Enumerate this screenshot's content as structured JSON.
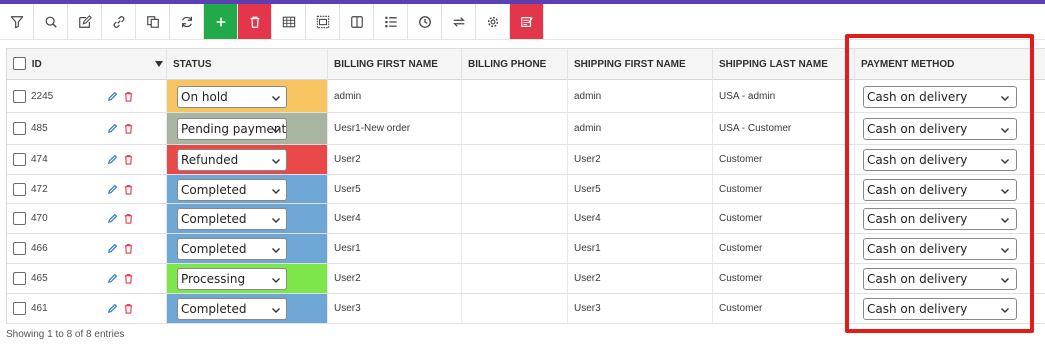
{
  "toolbar": {
    "buttons": [
      {
        "name": "filter-icon"
      },
      {
        "name": "search-icon"
      },
      {
        "name": "edit-icon"
      },
      {
        "name": "link-icon"
      },
      {
        "name": "copy-icon"
      },
      {
        "name": "refresh-icon"
      },
      {
        "name": "add-icon",
        "color": "#22a94a"
      },
      {
        "name": "delete-icon",
        "color": "#e4364b"
      },
      {
        "name": "table-icon"
      },
      {
        "name": "layout-icon"
      },
      {
        "name": "columns-icon"
      },
      {
        "name": "list-icon"
      },
      {
        "name": "history-icon"
      },
      {
        "name": "sync-icon"
      },
      {
        "name": "settings-icon"
      },
      {
        "name": "bulk-edit-icon",
        "color": "#e4364b"
      }
    ]
  },
  "table": {
    "headers": {
      "id": "ID",
      "status": "STATUS",
      "billing_first_name": "BILLING FIRST NAME",
      "billing_phone": "BILLING PHONE",
      "shipping_first_name": "SHIPPING FIRST NAME",
      "shipping_last_name": "SHIPPING LAST NAME",
      "payment_method": "PAYMENT METHOD"
    },
    "rows": [
      {
        "id": "2245",
        "status": "On hold",
        "status_color": "#f8c462",
        "billing_first_name": "admin",
        "billing_phone": "",
        "shipping_first_name": "admin",
        "shipping_last_name": "USA - admin",
        "payment_method": "Cash on delivery"
      },
      {
        "id": "485",
        "status": "Pending payment",
        "status_color": "#a8b5a1",
        "billing_first_name": "Uesr1-New order",
        "billing_phone": "",
        "shipping_first_name": "admin",
        "shipping_last_name": "USA - Customer",
        "payment_method": "Cash on delivery"
      },
      {
        "id": "474",
        "status": "Refunded",
        "status_color": "#e84848",
        "billing_first_name": "User2",
        "billing_phone": "",
        "shipping_first_name": "User2",
        "shipping_last_name": "Customer",
        "payment_method": "Cash on delivery"
      },
      {
        "id": "472",
        "status": "Completed",
        "status_color": "#6ea7d6",
        "billing_first_name": "User5",
        "billing_phone": "",
        "shipping_first_name": "User5",
        "shipping_last_name": "Customer",
        "payment_method": "Cash on delivery"
      },
      {
        "id": "470",
        "status": "Completed",
        "status_color": "#6ea7d6",
        "billing_first_name": "User4",
        "billing_phone": "",
        "shipping_first_name": "User4",
        "shipping_last_name": "Customer",
        "payment_method": "Cash on delivery"
      },
      {
        "id": "466",
        "status": "Completed",
        "status_color": "#6ea7d6",
        "billing_first_name": "Uesr1",
        "billing_phone": "",
        "shipping_first_name": "Uesr1",
        "shipping_last_name": "Customer",
        "payment_method": "Cash on delivery"
      },
      {
        "id": "465",
        "status": "Processing",
        "status_color": "#7de64a",
        "billing_first_name": "User2",
        "billing_phone": "",
        "shipping_first_name": "User2",
        "shipping_last_name": "Customer",
        "payment_method": "Cash on delivery"
      },
      {
        "id": "461",
        "status": "Completed",
        "status_color": "#6ea7d6",
        "billing_first_name": "User3",
        "billing_phone": "",
        "shipping_first_name": "User3",
        "shipping_last_name": "Customer",
        "payment_method": "Cash on delivery"
      }
    ]
  },
  "footer": {
    "entries_text": "Showing 1 to 8 of 8 entries"
  },
  "colors": {
    "accent_bar": "#5b3fb3",
    "highlight_border": "#e21b1b"
  }
}
